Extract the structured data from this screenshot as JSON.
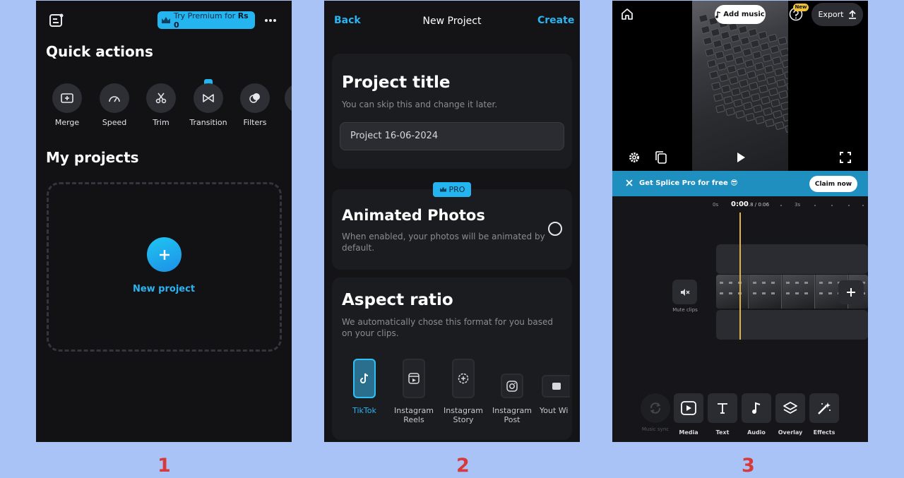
{
  "captions": [
    "1",
    "2",
    "3"
  ],
  "screen1": {
    "premium": {
      "prefix": "Try Premium for ",
      "amount": "Rs 0"
    },
    "quick_actions_title": "Quick actions",
    "quick_actions": [
      {
        "label": "Merge",
        "icon": "merge-icon"
      },
      {
        "label": "Speed",
        "icon": "speedometer-icon"
      },
      {
        "label": "Trim",
        "icon": "scissors-icon"
      },
      {
        "label": "Transition",
        "icon": "transition-icon"
      },
      {
        "label": "Filters",
        "icon": "filters-icon"
      }
    ],
    "my_projects_title": "My projects",
    "new_project_label": "New project"
  },
  "screen2": {
    "back": "Back",
    "title": "New Project",
    "create": "Create",
    "project_title": {
      "heading": "Project title",
      "subtitle": "You can skip this and change it later.",
      "value": "Project 16-06-2024"
    },
    "pro_badge": "PRO",
    "animated_photos": {
      "heading": "Animated Photos",
      "subtitle": "When enabled, your photos will be animated by default."
    },
    "aspect_ratio": {
      "heading": "Aspect ratio",
      "subtitle": "We automatically chose this format for you based on your clips.",
      "options": [
        {
          "label": "TikTok",
          "selected": true
        },
        {
          "label": "Instagram Reels"
        },
        {
          "label": "Instagram Story"
        },
        {
          "label": "Instagram Post"
        },
        {
          "label": "Yout Wides"
        }
      ]
    }
  },
  "screen3": {
    "add_music": "Add music",
    "new_badge": "New",
    "export": "Export",
    "banner_text": "Get Splice Pro for free 😎",
    "claim_now": "Claim now",
    "time_current": "0:00",
    "time_rest": ".8 / 0:06",
    "tick_0": "0s",
    "tick_3": "3s",
    "mute_clips": "Mute clips",
    "tools": [
      {
        "label": "Music sync",
        "icon": "music-sync-icon"
      },
      {
        "label": "Media",
        "icon": "media-icon"
      },
      {
        "label": "Text",
        "icon": "text-icon"
      },
      {
        "label": "Audio",
        "icon": "audio-icon"
      },
      {
        "label": "Overlay",
        "icon": "overlay-icon"
      },
      {
        "label": "Effects",
        "icon": "effects-icon"
      }
    ]
  },
  "colors": {
    "accent": "#24b4f0",
    "background": "#a9c3f7",
    "caption": "#d63a3a",
    "playhead": "#e0b24a"
  }
}
